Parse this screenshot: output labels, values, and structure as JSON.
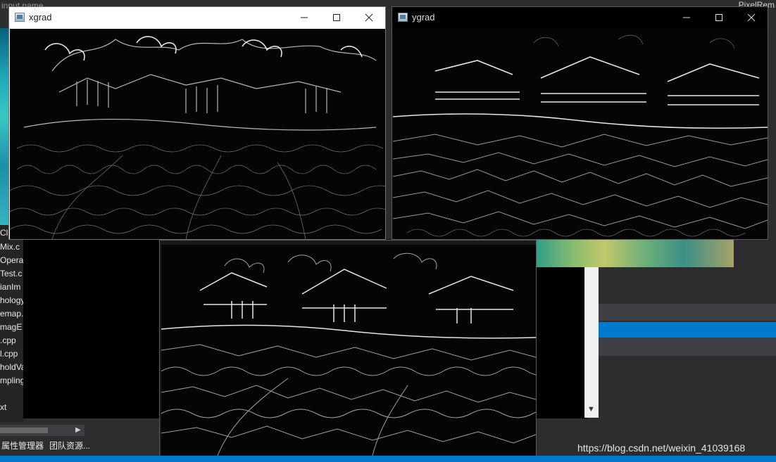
{
  "background_ide": {
    "top_left_text": "input name",
    "top_right_text": "PixelRem",
    "file_list": [
      "Cl",
      "Mix.c",
      "Opera",
      "Test.c",
      "ianIm",
      "hology",
      "emap.",
      "magE",
      ".cpp",
      "l.cpp",
      "holdVa",
      "mpling",
      "",
      "xt"
    ],
    "bottom_tabs": [
      "属性管理器",
      "团队资源..."
    ],
    "watermark": "https://blog.csdn.net/weixin_41039168"
  },
  "windows": {
    "xgrad": {
      "title": "xgrad",
      "minimize_icon": "minimize-icon",
      "maximize_icon": "maximize-icon",
      "close_icon": "close-icon"
    },
    "ygrad": {
      "title": "ygrad",
      "minimize_icon": "minimize-icon",
      "maximize_icon": "maximize-icon",
      "close_icon": "close-icon"
    },
    "combined": {
      "title": ""
    }
  },
  "colors": {
    "ide_background": "#2d2d30",
    "accent_blue": "#007acc",
    "edge_image_background": "#050505"
  }
}
